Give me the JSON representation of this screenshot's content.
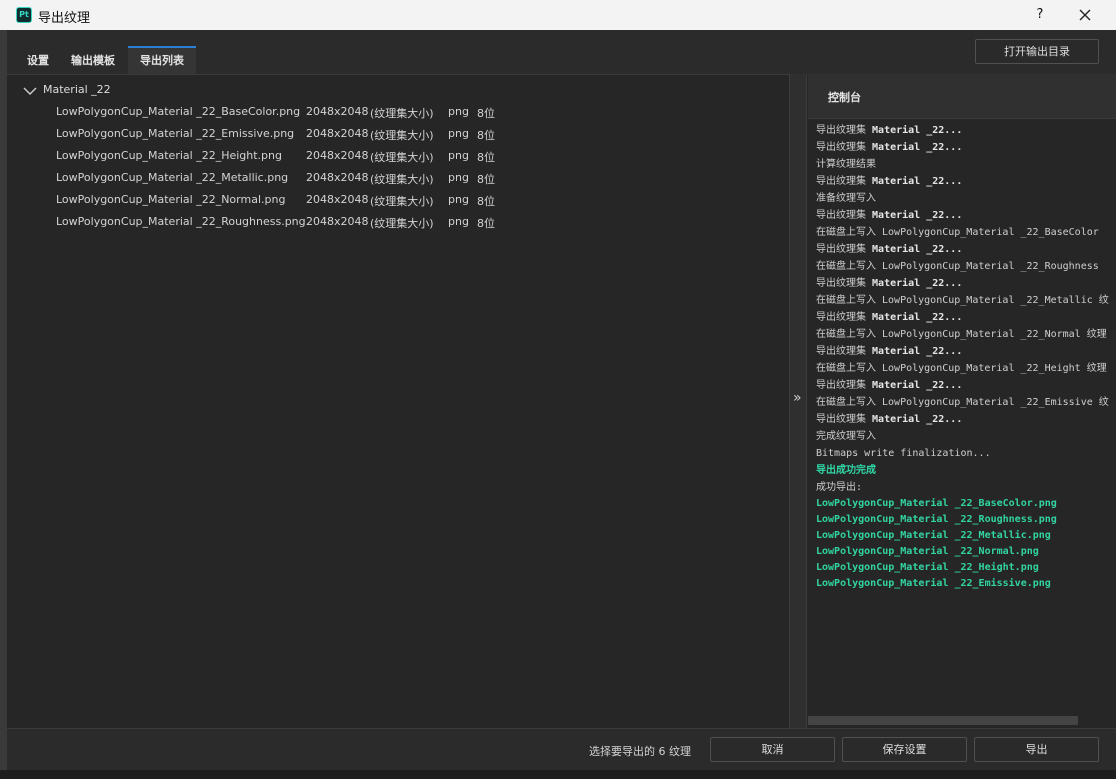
{
  "window": {
    "app_logo": "Pt",
    "title": "导出纹理",
    "help_label": "?",
    "close_icon": "close-icon"
  },
  "tabs": [
    {
      "label": "设置",
      "active": false
    },
    {
      "label": "输出模板",
      "active": false
    },
    {
      "label": "导出列表",
      "active": true
    }
  ],
  "toolbar": {
    "open_output_label": "打开输出目录"
  },
  "export_list": {
    "group": "Material _22",
    "files": [
      {
        "name": "LowPolygonCup_Material _22_BaseColor.png",
        "resolution": "2048x2048",
        "note": "(纹理集大小)",
        "format": "png",
        "bits": "8位"
      },
      {
        "name": "LowPolygonCup_Material _22_Emissive.png",
        "resolution": "2048x2048",
        "note": "(纹理集大小)",
        "format": "png",
        "bits": "8位"
      },
      {
        "name": "LowPolygonCup_Material _22_Height.png",
        "resolution": "2048x2048",
        "note": "(纹理集大小)",
        "format": "png",
        "bits": "8位"
      },
      {
        "name": "LowPolygonCup_Material _22_Metallic.png",
        "resolution": "2048x2048",
        "note": "(纹理集大小)",
        "format": "png",
        "bits": "8位"
      },
      {
        "name": "LowPolygonCup_Material _22_Normal.png",
        "resolution": "2048x2048",
        "note": "(纹理集大小)",
        "format": "png",
        "bits": "8位"
      },
      {
        "name": "LowPolygonCup_Material _22_Roughness.png",
        "resolution": "2048x2048",
        "note": "(纹理集大小)",
        "format": "png",
        "bits": "8位"
      }
    ]
  },
  "splitter": {
    "arrow": "»"
  },
  "console": {
    "title": "控制台",
    "lines": [
      {
        "prefix": "导出纹理集 ",
        "bold": "Material _22...",
        "kind": "normal"
      },
      {
        "prefix": "导出纹理集 ",
        "bold": "Material _22...",
        "kind": "normal"
      },
      {
        "prefix": "计算纹理结果",
        "bold": "",
        "kind": "normal"
      },
      {
        "prefix": "导出纹理集 ",
        "bold": "Material _22...",
        "kind": "normal"
      },
      {
        "prefix": "准备纹理写入",
        "bold": "",
        "kind": "normal"
      },
      {
        "prefix": "导出纹理集 ",
        "bold": "Material _22...",
        "kind": "normal"
      },
      {
        "prefix": "在磁盘上写入 LowPolygonCup_Material _22_BaseColor",
        "bold": "",
        "kind": "normal"
      },
      {
        "prefix": "导出纹理集 ",
        "bold": "Material _22...",
        "kind": "normal"
      },
      {
        "prefix": "在磁盘上写入 LowPolygonCup_Material _22_Roughness",
        "bold": "",
        "kind": "normal"
      },
      {
        "prefix": "导出纹理集 ",
        "bold": "Material _22...",
        "kind": "normal"
      },
      {
        "prefix": "在磁盘上写入 LowPolygonCup_Material _22_Metallic 纹",
        "bold": "",
        "kind": "normal"
      },
      {
        "prefix": "导出纹理集 ",
        "bold": "Material _22...",
        "kind": "normal"
      },
      {
        "prefix": "在磁盘上写入 LowPolygonCup_Material _22_Normal 纹理",
        "bold": "",
        "kind": "normal"
      },
      {
        "prefix": "导出纹理集 ",
        "bold": "Material _22...",
        "kind": "normal"
      },
      {
        "prefix": "在磁盘上写入 LowPolygonCup_Material _22_Height 纹理",
        "bold": "",
        "kind": "normal"
      },
      {
        "prefix": "导出纹理集 ",
        "bold": "Material _22...",
        "kind": "normal"
      },
      {
        "prefix": "在磁盘上写入 LowPolygonCup_Material _22_Emissive 纹",
        "bold": "",
        "kind": "normal"
      },
      {
        "prefix": "导出纹理集 ",
        "bold": "Material _22...",
        "kind": "normal"
      },
      {
        "prefix": "完成纹理写入",
        "bold": "",
        "kind": "normal"
      },
      {
        "prefix": "Bitmaps write finalization...",
        "bold": "",
        "kind": "normal"
      },
      {
        "prefix": "导出成功完成",
        "bold": "",
        "kind": "green"
      },
      {
        "prefix": "成功导出:",
        "bold": "",
        "kind": "normal"
      }
    ],
    "exported_files": [
      "LowPolygonCup_Material _22_BaseColor.png",
      "LowPolygonCup_Material _22_Roughness.png",
      "LowPolygonCup_Material _22_Metallic.png",
      "LowPolygonCup_Material _22_Normal.png",
      "LowPolygonCup_Material _22_Height.png",
      "LowPolygonCup_Material _22_Emissive.png"
    ]
  },
  "footer": {
    "status": "选择要导出的 6 纹理",
    "cancel_label": "取消",
    "save_settings_label": "保存设置",
    "export_label": "导出"
  },
  "colors": {
    "accent": "#2d7fd3",
    "success": "#2fd8a6",
    "logo": "#39d6c0"
  }
}
